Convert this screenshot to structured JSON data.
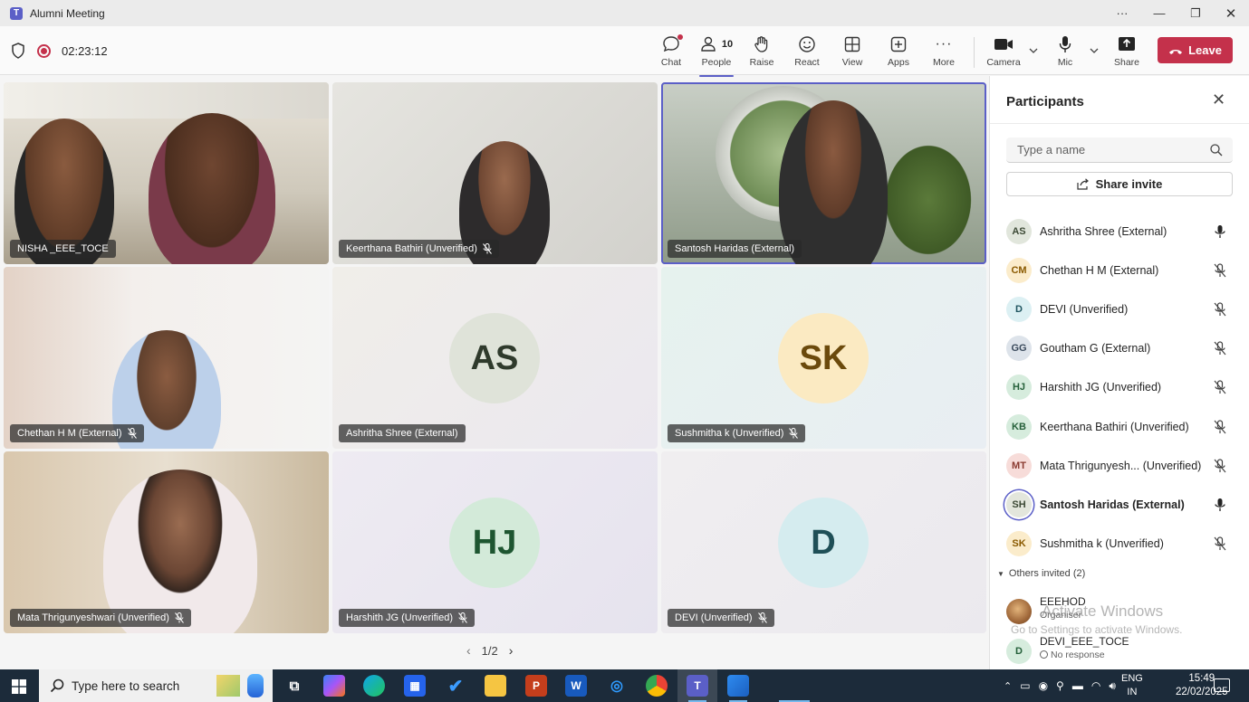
{
  "window": {
    "title": "Alumni Meeting"
  },
  "toolbar": {
    "timer": "02:23:12",
    "people_count": "10",
    "buttons": {
      "chat": "Chat",
      "people": "People",
      "raise": "Raise",
      "react": "React",
      "view": "View",
      "apps": "Apps",
      "more": "More",
      "camera": "Camera",
      "mic": "Mic",
      "share": "Share"
    },
    "leave": "Leave"
  },
  "grid": {
    "tiles": [
      {
        "name": "NISHA _EEE_TOCE",
        "muted": false,
        "type": "video"
      },
      {
        "name": "Keerthana Bathiri (Unverified)",
        "muted": true,
        "type": "video"
      },
      {
        "name": "Santosh Haridas (External)",
        "muted": false,
        "type": "video",
        "speaking": true
      },
      {
        "name": "Chethan H M (External)",
        "muted": true,
        "type": "video"
      },
      {
        "name": "Ashritha Shree (External)",
        "muted": false,
        "type": "avatar",
        "initials": "AS",
        "avatar_bg": "#dfe3d9",
        "avatar_fg": "#2f3a2c"
      },
      {
        "name": "Sushmitha k (Unverified)",
        "muted": true,
        "type": "avatar",
        "initials": "SK",
        "avatar_bg": "#fbeac2",
        "avatar_fg": "#6b4a0c"
      },
      {
        "name": "Mata Thrigunyeshwari (Unverified)",
        "muted": true,
        "type": "video"
      },
      {
        "name": "Harshith JG (Unverified)",
        "muted": true,
        "type": "avatar",
        "initials": "HJ",
        "avatar_bg": "#d3ead9",
        "avatar_fg": "#1e5631"
      },
      {
        "name": "DEVI (Unverified)",
        "muted": true,
        "type": "avatar",
        "initials": "D",
        "avatar_bg": "#d5ecef",
        "avatar_fg": "#1f4f57"
      }
    ],
    "pager": "1/2"
  },
  "panel": {
    "title": "Participants",
    "search_placeholder": "Type a name",
    "share_invite": "Share invite",
    "participants": [
      {
        "initials": "AS",
        "name": "Ashritha Shree (External)",
        "muted": false,
        "bg": "#e1e6dc",
        "fg": "#3d4a36"
      },
      {
        "initials": "CM",
        "name": "Chethan H M (External)",
        "muted": true,
        "bg": "#fbeccb",
        "fg": "#8a5a00"
      },
      {
        "initials": "D",
        "name": "DEVI (Unverified)",
        "muted": true,
        "bg": "#dcf0f3",
        "fg": "#1f5560"
      },
      {
        "initials": "GG",
        "name": "Goutham G (External)",
        "muted": true,
        "bg": "#dde3ea",
        "fg": "#3a4a5c"
      },
      {
        "initials": "HJ",
        "name": "Harshith JG (Unverified)",
        "muted": true,
        "bg": "#d6ecdd",
        "fg": "#25603a"
      },
      {
        "initials": "KB",
        "name": "Keerthana Bathiri (Unverified)",
        "muted": true,
        "bg": "#d6ecdd",
        "fg": "#25603a"
      },
      {
        "initials": "MT",
        "name": "Mata Thrigunyesh...  (Unverified)",
        "muted": true,
        "bg": "#f7dcd9",
        "fg": "#8a3a30"
      },
      {
        "initials": "SH",
        "name": "Santosh Haridas (External)",
        "muted": false,
        "bg": "#e3e6dc",
        "fg": "#3d4a36",
        "speaking": true
      },
      {
        "initials": "SK",
        "name": "Sushmitha k (Unverified)",
        "muted": true,
        "bg": "#fbeccb",
        "fg": "#8a5a00"
      }
    ],
    "others_label": "Others invited (2)",
    "invited": [
      {
        "initials": "",
        "name": "EEEHOD",
        "status": "Organiser",
        "photo": true
      },
      {
        "initials": "D",
        "name": "DEVI_EEE_TOCE",
        "status": "No response",
        "photo": false
      }
    ]
  },
  "watermark": {
    "line1": "Activate Windows",
    "line2": "Go to Settings to activate Windows."
  },
  "taskbar": {
    "search_placeholder": "Type here to search",
    "lang_line1": "ENG",
    "lang_line2": "IN",
    "time": "15:49",
    "date": "22/02/2025"
  },
  "colors": {
    "accent": "#5b5fc7",
    "leave": "#c4314b",
    "taskbar": "#1c2b3a"
  }
}
